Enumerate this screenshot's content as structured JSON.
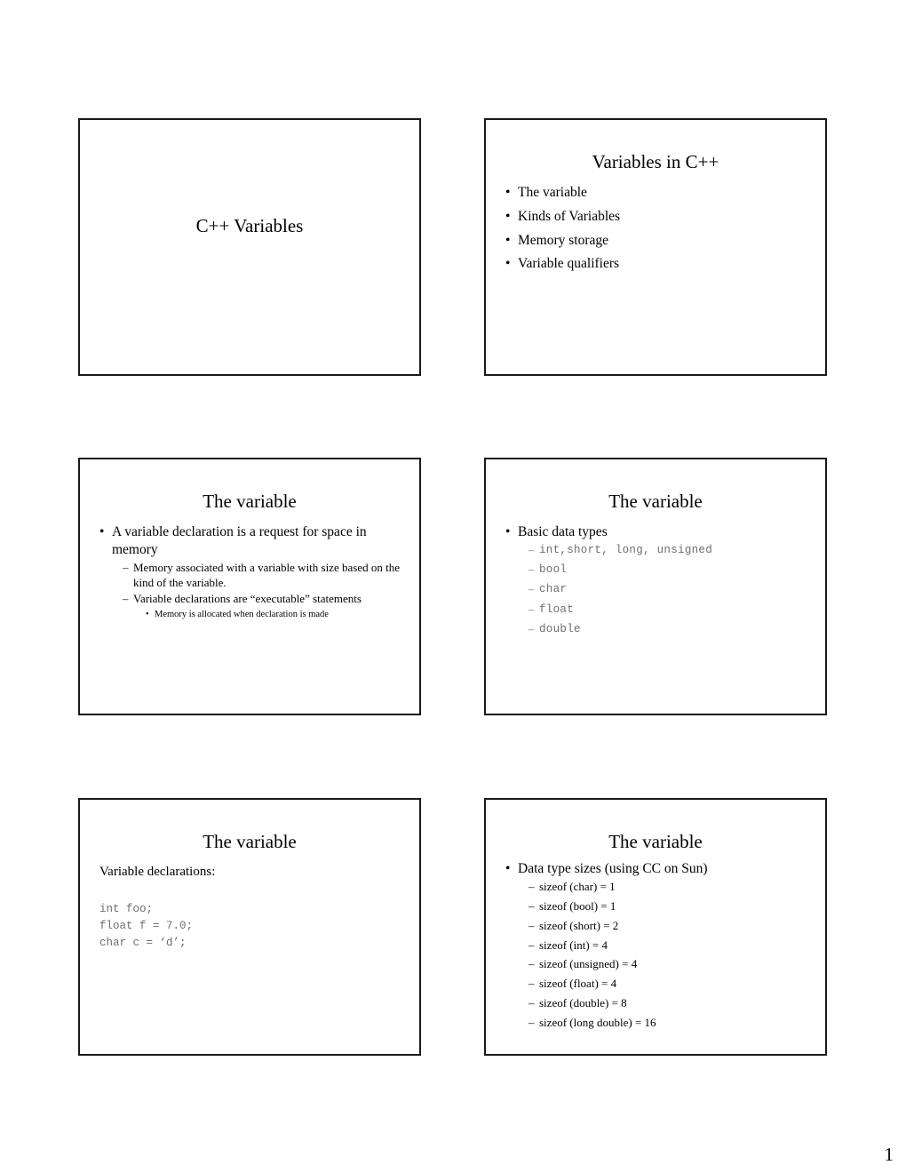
{
  "document": {
    "type": "presentation-handout",
    "page_number": "1",
    "slides_per_page": 6
  },
  "slides": [
    {
      "id": "slide-1",
      "title": "C++ Variables",
      "layout": "title-only",
      "bullets": []
    },
    {
      "id": "slide-2",
      "title": "Variables in C++",
      "layout": "title-and-content",
      "bullets": [
        {
          "level": 1,
          "marker": "•",
          "text": "The variable"
        },
        {
          "level": 1,
          "marker": "•",
          "text": "Kinds of Variables"
        },
        {
          "level": 1,
          "marker": "•",
          "text": "Memory storage"
        },
        {
          "level": 1,
          "marker": "•",
          "text": "Variable qualifiers"
        }
      ]
    },
    {
      "id": "slide-3",
      "title": "The variable",
      "layout": "title-and-content",
      "bullets": [
        {
          "level": 1,
          "marker": "•",
          "text": "A variable declaration is a request for space in memory"
        },
        {
          "level": 2,
          "marker": "–",
          "text": "Memory associated with a variable with size based on the kind of the variable."
        },
        {
          "level": 2,
          "marker": "–",
          "text": "Variable declarations are “executable” statements"
        },
        {
          "level": 3,
          "marker": "•",
          "text": "Memory is allocated when declaration is made"
        }
      ]
    },
    {
      "id": "slide-4",
      "title": "The variable",
      "layout": "title-and-content",
      "bullets": [
        {
          "level": 1,
          "marker": "•",
          "text": "Basic data types",
          "mono": false
        },
        {
          "level": 2,
          "marker": "–",
          "text": "int,short, long, unsigned",
          "mono": true
        },
        {
          "level": 2,
          "marker": "–",
          "text": "bool",
          "mono": true
        },
        {
          "level": 2,
          "marker": "–",
          "text": "char",
          "mono": true
        },
        {
          "level": 2,
          "marker": "–",
          "text": "float",
          "mono": true
        },
        {
          "level": 2,
          "marker": "–",
          "text": "double",
          "mono": true
        }
      ]
    },
    {
      "id": "slide-5",
      "title": "The variable",
      "layout": "title-and-code",
      "lead_text": "Variable declarations:",
      "code": "int foo;\nfloat f = 7.0;\nchar c = ‘d’;"
    },
    {
      "id": "slide-6",
      "title": "The variable",
      "layout": "title-and-content",
      "bullets": [
        {
          "level": 1,
          "marker": "•",
          "text": "Data type sizes (using CC on Sun)"
        },
        {
          "level": 2,
          "marker": "–",
          "text": "sizeof (char) = 1"
        },
        {
          "level": 2,
          "marker": "–",
          "text": "sizeof (bool) = 1"
        },
        {
          "level": 2,
          "marker": "–",
          "text": "sizeof (short) = 2"
        },
        {
          "level": 2,
          "marker": "–",
          "text": "sizeof (int) = 4"
        },
        {
          "level": 2,
          "marker": "–",
          "text": "sizeof (unsigned) = 4"
        },
        {
          "level": 2,
          "marker": "–",
          "text": "sizeof (float) = 4"
        },
        {
          "level": 2,
          "marker": "–",
          "text": "sizeof (double) = 8"
        },
        {
          "level": 2,
          "marker": "–",
          "text": "sizeof (long double) = 16"
        }
      ]
    }
  ],
  "colors": {
    "slide_border": "#1a1a1a",
    "text": "#000000",
    "mono_text": "#6e6e6e",
    "page_background": "#ffffff"
  }
}
